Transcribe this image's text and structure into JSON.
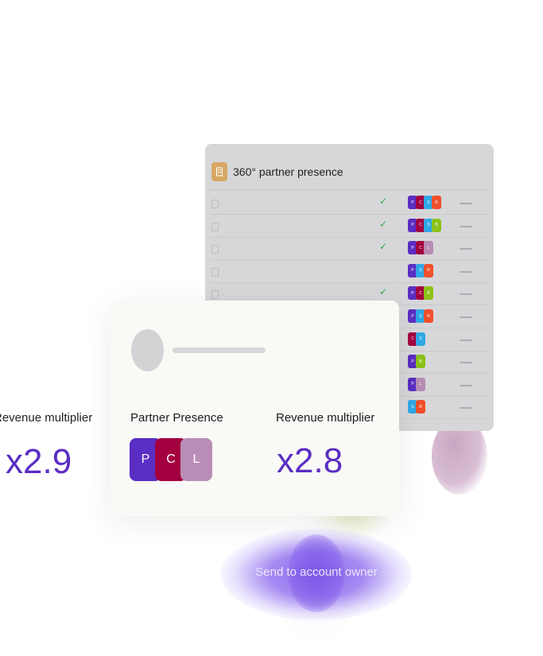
{
  "back_panel": {
    "title": "360° partner presence",
    "rows": [
      {
        "check": true,
        "chips": [
          {
            "t": "P",
            "c": "#5a2dc3"
          },
          {
            "t": "C",
            "c": "#a3003f"
          },
          {
            "t": "S",
            "c": "#2ea9e6"
          },
          {
            "t": "R",
            "c": "#f0502c"
          }
        ]
      },
      {
        "check": true,
        "chips": [
          {
            "t": "P",
            "c": "#5a2dc3"
          },
          {
            "t": "C",
            "c": "#a3003f"
          },
          {
            "t": "S",
            "c": "#2ea9e6"
          },
          {
            "t": "B",
            "c": "#8cc21a"
          }
        ]
      },
      {
        "check": true,
        "chips": [
          {
            "t": "P",
            "c": "#5a2dc3"
          },
          {
            "t": "C",
            "c": "#a3003f"
          },
          {
            "t": "L",
            "c": "#b98db5"
          }
        ]
      },
      {
        "check": false,
        "chips": [
          {
            "t": "P",
            "c": "#5a2dc3"
          },
          {
            "t": "S",
            "c": "#2ea9e6"
          },
          {
            "t": "R",
            "c": "#f0502c"
          }
        ]
      },
      {
        "check": true,
        "chips": [
          {
            "t": "P",
            "c": "#5a2dc3"
          },
          {
            "t": "C",
            "c": "#a3003f"
          },
          {
            "t": "B",
            "c": "#8cc21a"
          }
        ]
      },
      {
        "check": false,
        "chips": [
          {
            "t": "P",
            "c": "#5a2dc3"
          },
          {
            "t": "S",
            "c": "#2ea9e6"
          },
          {
            "t": "R",
            "c": "#f0502c"
          }
        ]
      },
      {
        "check": false,
        "chips": [
          {
            "t": "C",
            "c": "#a3003f"
          },
          {
            "t": "S",
            "c": "#2ea9e6"
          }
        ]
      },
      {
        "check": false,
        "chips": [
          {
            "t": "P",
            "c": "#5a2dc3"
          },
          {
            "t": "B",
            "c": "#8cc21a"
          }
        ]
      },
      {
        "check": false,
        "chips": [
          {
            "t": "P",
            "c": "#5a2dc3"
          },
          {
            "t": "L",
            "c": "#b98db5"
          }
        ]
      },
      {
        "check": false,
        "chips": [
          {
            "t": "S",
            "c": "#2ea9e6"
          },
          {
            "t": "R",
            "c": "#f0502c"
          }
        ]
      }
    ]
  },
  "ghost": {
    "label": "Revenue multiplier",
    "value": "x2.9"
  },
  "card": {
    "partner_label": "Partner Presence",
    "partners": [
      {
        "t": "P",
        "c": "#5a2dc3"
      },
      {
        "t": "C",
        "c": "#a3003f"
      },
      {
        "t": "L",
        "c": "#b98db5"
      }
    ],
    "revenue_label": "Revenue multiplier",
    "revenue_value": "x2.8"
  },
  "send_button": "Send to account owner",
  "colors": {
    "accent": "#5a2dc3",
    "panel_icon": "#d7a865",
    "check": "#2ea64e"
  },
  "icons": {
    "panel_icon": "building-icon",
    "check": "checkmark-icon"
  }
}
